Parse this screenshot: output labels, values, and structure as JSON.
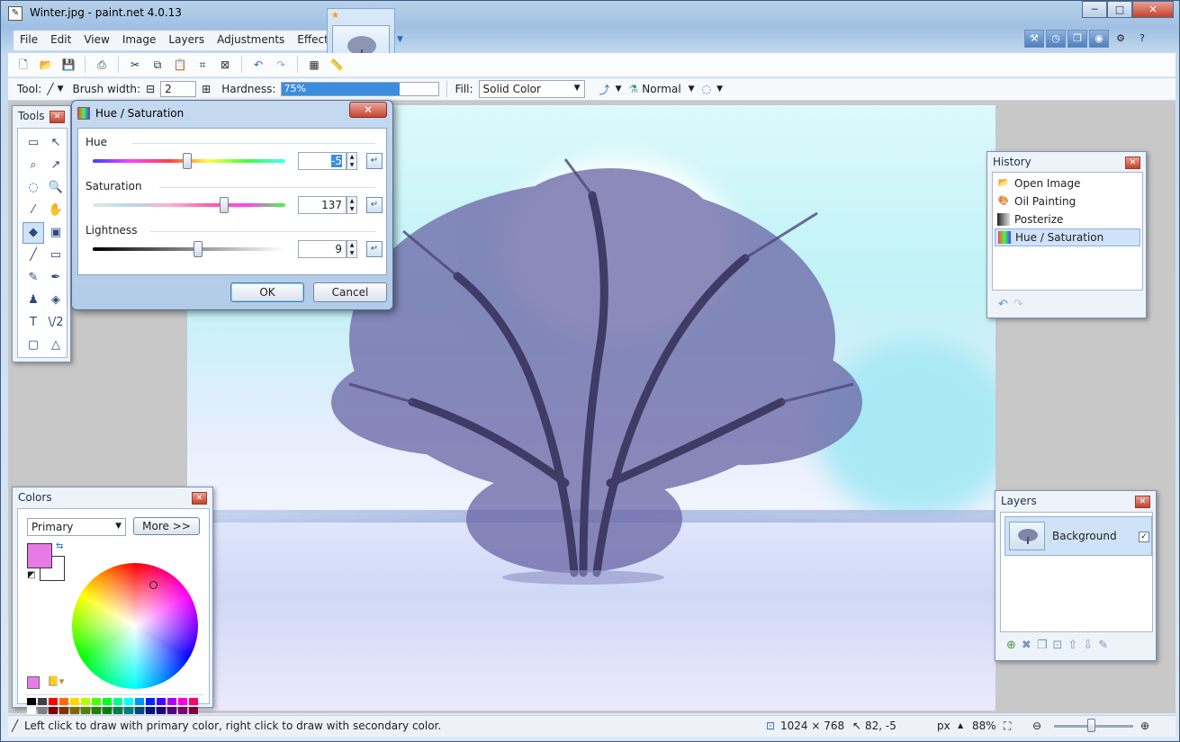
{
  "window": {
    "title": "Winter.jpg - paint.net 4.0.13",
    "app_icon": "paint-icon",
    "controls": [
      "─",
      "□",
      "✕"
    ]
  },
  "menu": [
    "File",
    "Edit",
    "View",
    "Image",
    "Layers",
    "Adjustments",
    "Effects"
  ],
  "toolbar_icons": [
    "new-icon",
    "open-icon",
    "save-icon",
    "print-icon",
    "cut-icon",
    "copy-icon",
    "paste-icon",
    "crop-icon",
    "deselect-icon",
    "undo-icon",
    "redo-icon",
    "grid-icon",
    "ruler-icon"
  ],
  "options": {
    "tool_label": "Tool:",
    "brush_width_label": "Brush width:",
    "brush_width_value": "2",
    "hardness_label": "Hardness:",
    "hardness_value": "75%",
    "hardness_fraction": 0.75,
    "fill_label": "Fill:",
    "fill_value": "Solid Color",
    "blend_value": "Normal"
  },
  "tools_panel": {
    "title": "Tools",
    "tools": [
      "▭",
      "↖",
      "⌕",
      "↗",
      "◌",
      "🔍",
      "⁄",
      "✋",
      "◆",
      "▣",
      "╱",
      "▭",
      "✎",
      "✒",
      "♟",
      "◈",
      "T",
      "\\/2",
      "▢",
      "△"
    ],
    "active_index": 8
  },
  "dialog": {
    "title": "Hue / Saturation",
    "hue_label": "Hue",
    "hue_value": "-5",
    "saturation_label": "Saturation",
    "saturation_value": "137",
    "lightness_label": "Lightness",
    "lightness_value": "9",
    "ok_label": "OK",
    "cancel_label": "Cancel",
    "close_label": "✕"
  },
  "history": {
    "title": "History",
    "items": [
      "Open Image",
      "Oil Painting",
      "Posterize",
      "Hue / Saturation"
    ],
    "selected_index": 3
  },
  "colors": {
    "title": "Colors",
    "mode": "Primary",
    "more_label": "More >>",
    "primary_color": "#e87ae8",
    "secondary_color": "#ffffff",
    "palette": [
      "#000000",
      "#404040",
      "#ff0000",
      "#ff6a00",
      "#ffd800",
      "#b6ff00",
      "#4cff00",
      "#00ff21",
      "#00ff90",
      "#00ffff",
      "#0094ff",
      "#0026ff",
      "#4800ff",
      "#b200ff",
      "#ff00dc",
      "#ff006e",
      "#ffffff",
      "#808080",
      "#7f0000",
      "#7f3300",
      "#7f6a00",
      "#5b7f00",
      "#267f00",
      "#007f0e",
      "#007f46",
      "#007f7f",
      "#004a7f",
      "#00137f",
      "#21007f",
      "#57007f",
      "#7f006e",
      "#7f0037"
    ]
  },
  "layers": {
    "title": "Layers",
    "items": [
      {
        "name": "Background",
        "visible": true
      }
    ]
  },
  "status": {
    "hint": "Left click to draw with primary color, right click to draw with secondary color.",
    "image_size": "1024 × 768",
    "cursor_pos": "82, -5",
    "unit": "px",
    "zoom": "88%"
  }
}
